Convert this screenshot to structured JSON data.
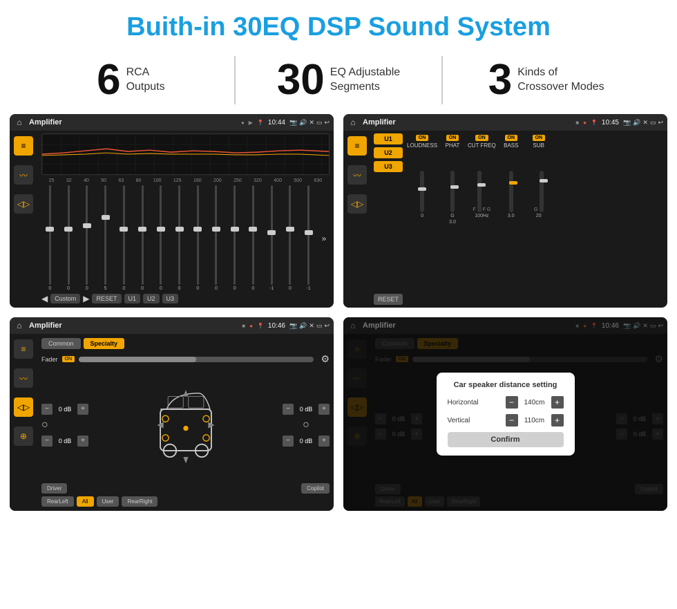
{
  "page": {
    "title": "Buith-in 30EQ DSP Sound System"
  },
  "stats": [
    {
      "number": "6",
      "text": "RCA\nOutputs"
    },
    {
      "number": "30",
      "text": "EQ Adjustable\nSegments"
    },
    {
      "number": "3",
      "text": "Kinds of\nCrossover Modes"
    }
  ],
  "screens": {
    "screen1": {
      "status_bar": {
        "title": "Amplifier",
        "time": "10:44"
      },
      "eq_frequencies": [
        "25",
        "32",
        "40",
        "50",
        "63",
        "80",
        "100",
        "125",
        "160",
        "200",
        "250",
        "320",
        "400",
        "500",
        "630"
      ],
      "eq_values": [
        "0",
        "0",
        "0",
        "5",
        "0",
        "0",
        "0",
        "0",
        "0",
        "0",
        "0",
        "0",
        "-1",
        "0",
        "-1"
      ],
      "buttons": [
        "Custom",
        "RESET",
        "U1",
        "U2",
        "U3"
      ]
    },
    "screen2": {
      "status_bar": {
        "title": "Amplifier",
        "time": "10:45"
      },
      "presets": [
        "U1",
        "U2",
        "U3"
      ],
      "channels": [
        "LOUDNESS",
        "PHAT",
        "CUT FREQ",
        "BASS",
        "SUB"
      ],
      "reset_label": "RESET"
    },
    "screen3": {
      "status_bar": {
        "title": "Amplifier",
        "time": "10:46"
      },
      "tabs": [
        "Common",
        "Specialty"
      ],
      "fader_label": "Fader",
      "fader_on": "ON",
      "volumes": [
        "0 dB",
        "0 dB",
        "0 dB",
        "0 dB"
      ],
      "bottom_buttons": [
        "Driver",
        "Copilot",
        "RearLeft",
        "All",
        "User",
        "RearRight"
      ]
    },
    "screen4": {
      "status_bar": {
        "title": "Amplifier",
        "time": "10:46"
      },
      "tabs": [
        "Common",
        "Specialty"
      ],
      "dialog": {
        "title": "Car speaker distance setting",
        "horizontal_label": "Horizontal",
        "horizontal_value": "140cm",
        "vertical_label": "Vertical",
        "vertical_value": "110cm",
        "confirm_label": "Confirm"
      },
      "right_volumes": [
        "0 dB",
        "0 dB"
      ],
      "bottom_buttons": [
        "Driver",
        "Copilot",
        "RearLeft",
        "All",
        "User",
        "RearRight"
      ]
    }
  }
}
